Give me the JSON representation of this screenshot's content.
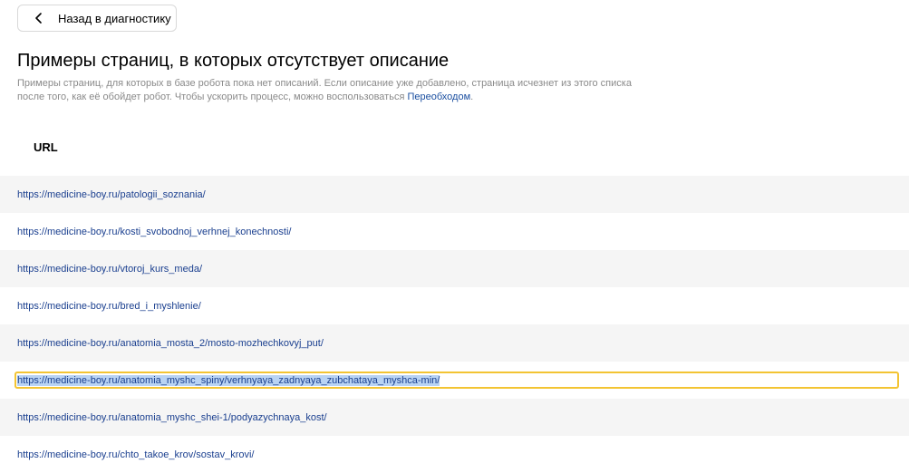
{
  "back_button": {
    "label": "Назад в диагностику",
    "icon": "chevron-left-icon"
  },
  "title": "Примеры страниц, в которых отсутствует описание",
  "description": {
    "text": "Примеры страниц, для которых в базе робота пока нет описаний. Если описание уже добавлено, страница исчезнет из этого списка после того, как её обойдет робот. Чтобы ускорить процесс, можно воспользоваться ",
    "link_label": "Переобходом",
    "suffix": "."
  },
  "table": {
    "column_header": "URL",
    "rows": [
      "https://medicine-boy.ru/patologii_soznania/",
      "https://medicine-boy.ru/kosti_svobodnoj_verhnej_konechnosti/",
      "https://medicine-boy.ru/vtoroj_kurs_meda/",
      "https://medicine-boy.ru/bred_i_myshlenie/",
      "https://medicine-boy.ru/anatomia_mosta_2/mosto-mozhechkovyj_put/",
      "https://medicine-boy.ru/anatomia_myshc_spiny/verhnyaya_zadnyaya_zubchataya_myshca-min/",
      "https://medicine-boy.ru/anatomia_myshc_shei-1/podyazychnaya_kost/",
      "https://medicine-boy.ru/chto_takoe_krov/sostav_krovi/"
    ]
  },
  "colors": {
    "link": "#1a3f8f",
    "selection_border": "#f3c433",
    "selection_fill": "#b8d3f4",
    "row_alt": "#f5f5f5"
  }
}
